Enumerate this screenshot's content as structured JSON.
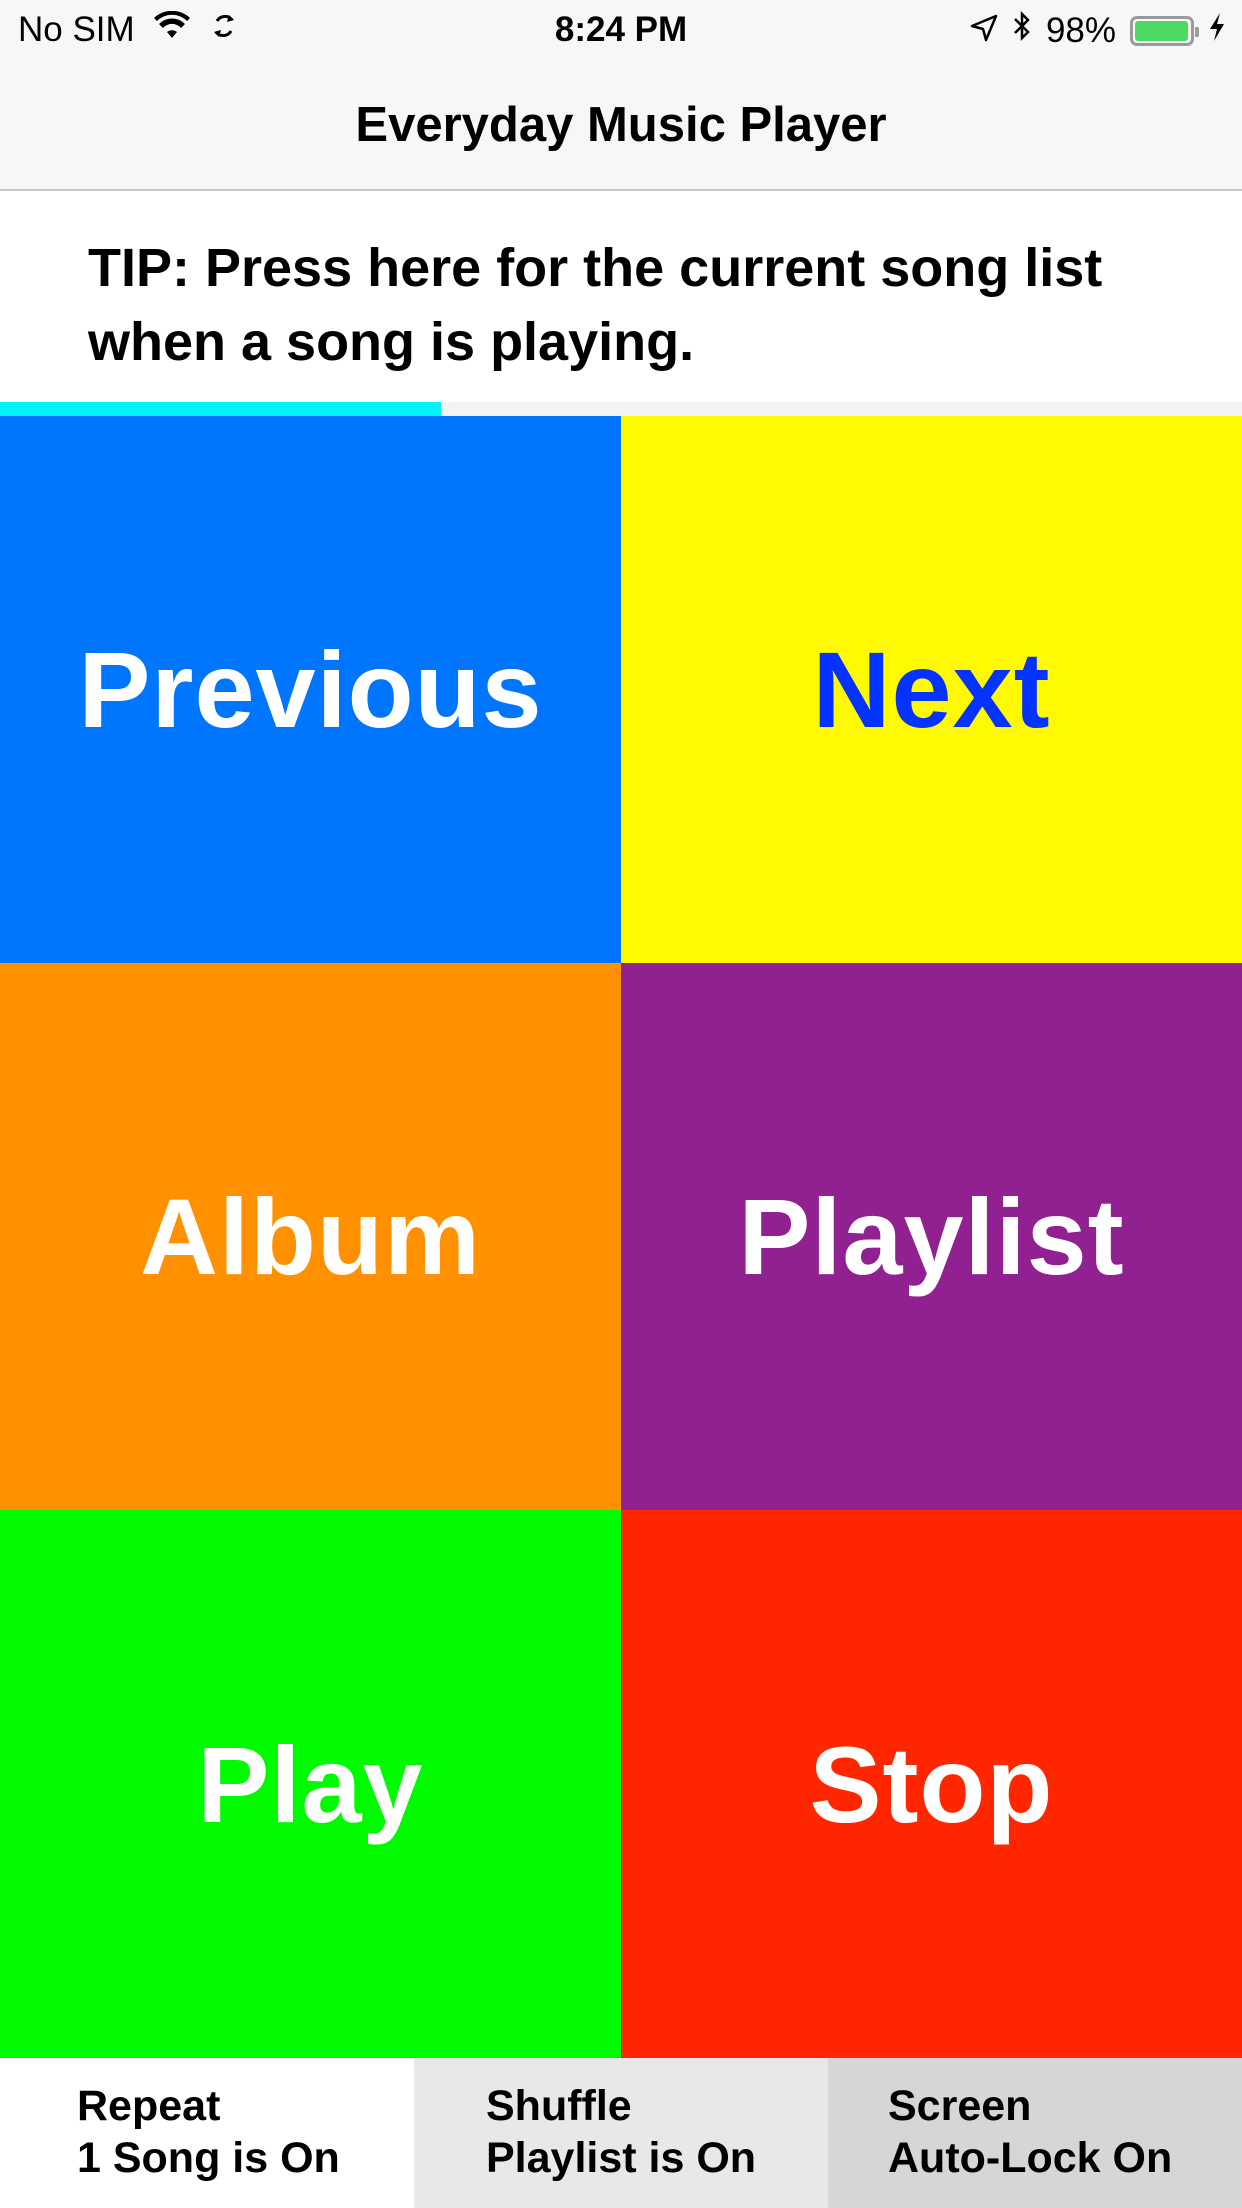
{
  "status_bar": {
    "carrier": "No SIM",
    "time": "8:24 PM",
    "battery_percent": "98%",
    "battery_level": 0.98,
    "icons": [
      "wifi-icon",
      "sync-icon",
      "location-arrow-icon",
      "bluetooth-icon",
      "battery-icon",
      "charging-bolt-icon"
    ]
  },
  "nav": {
    "title": "Everyday Music Player"
  },
  "tip": {
    "text": "TIP:  Press here for the current song list when a song is playing."
  },
  "progress": {
    "fraction": 0.355,
    "color": "#00f3f8"
  },
  "buttons": {
    "previous": {
      "label": "Previous",
      "color": "#0076fe"
    },
    "next": {
      "label": "Next",
      "color": "#fffa00",
      "text_color": "#0433ff"
    },
    "album": {
      "label": "Album",
      "color": "#ff9100"
    },
    "playlist": {
      "label": "Playlist",
      "color": "#912191"
    },
    "play": {
      "label": "Play",
      "color": "#00fa00"
    },
    "stop": {
      "label": "Stop",
      "color": "#ff2600"
    }
  },
  "toggles": {
    "repeat": {
      "line1": "Repeat",
      "line2": "1 Song is On"
    },
    "shuffle": {
      "line1": "Shuffle",
      "line2": "Playlist is On"
    },
    "autolock": {
      "line1": "Screen",
      "line2": "Auto-Lock On"
    }
  }
}
